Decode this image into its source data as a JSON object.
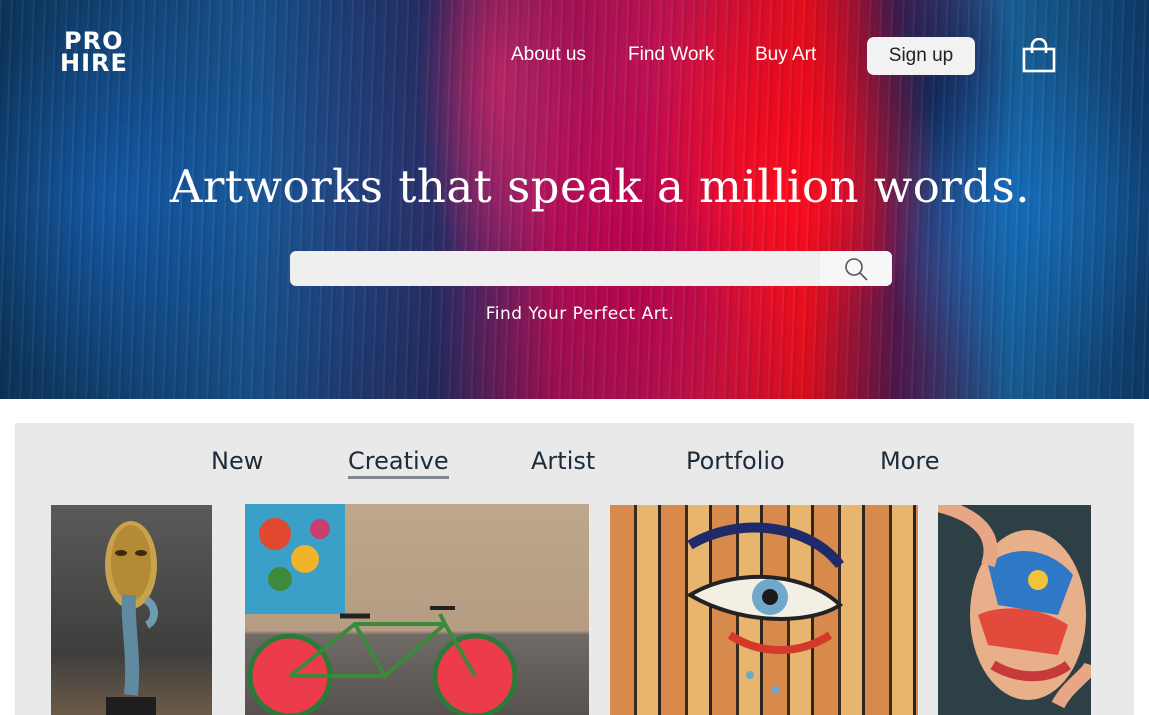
{
  "brand": {
    "logo_line1": "PRO",
    "logo_line2": "HIRE"
  },
  "nav": {
    "items": [
      "About us",
      "Find Work",
      "Buy Art"
    ],
    "signup_label": "Sign up",
    "cart_icon": "shopping-bag-icon"
  },
  "hero": {
    "headline": "Artworks that speak a million words.",
    "search_placeholder": "",
    "search_icon": "search-icon",
    "tagline": "Find Your Perfect Art."
  },
  "gallery": {
    "tabs": [
      "New",
      "Creative",
      "Artist",
      "Portfolio",
      "More"
    ],
    "active_tab": "Creative",
    "cards": [
      "mask-sculpture",
      "watermelon-bicycle",
      "painted-fence-eye",
      "face-paint-portrait"
    ]
  },
  "colors": {
    "text_dark": "#1d2b3a",
    "panel_bg": "#e9e9e9",
    "button_bg": "#f2f2f2"
  }
}
